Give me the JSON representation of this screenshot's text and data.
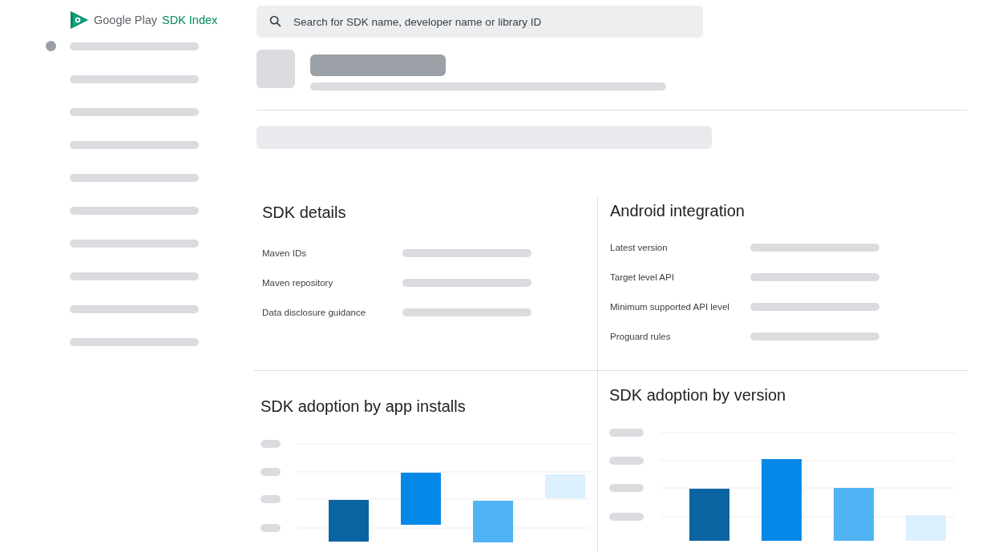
{
  "logo": {
    "brand": "Google Play",
    "product": "SDK Index"
  },
  "search": {
    "placeholder": "Search for SDK name, developer name or library ID"
  },
  "sdk_details": {
    "title": "SDK details",
    "fields": [
      "Maven IDs",
      "Maven repository",
      "Data disclosure guidance"
    ]
  },
  "android_integration": {
    "title": "Android integration",
    "fields": [
      "Latest version",
      "Target level API",
      "Minimum supported API level",
      "Proguard rules"
    ]
  },
  "charts": [
    {
      "title": "SDK adoption by app installs",
      "kind": "installs"
    },
    {
      "title": "SDK adoption by version",
      "kind": "version"
    }
  ]
}
